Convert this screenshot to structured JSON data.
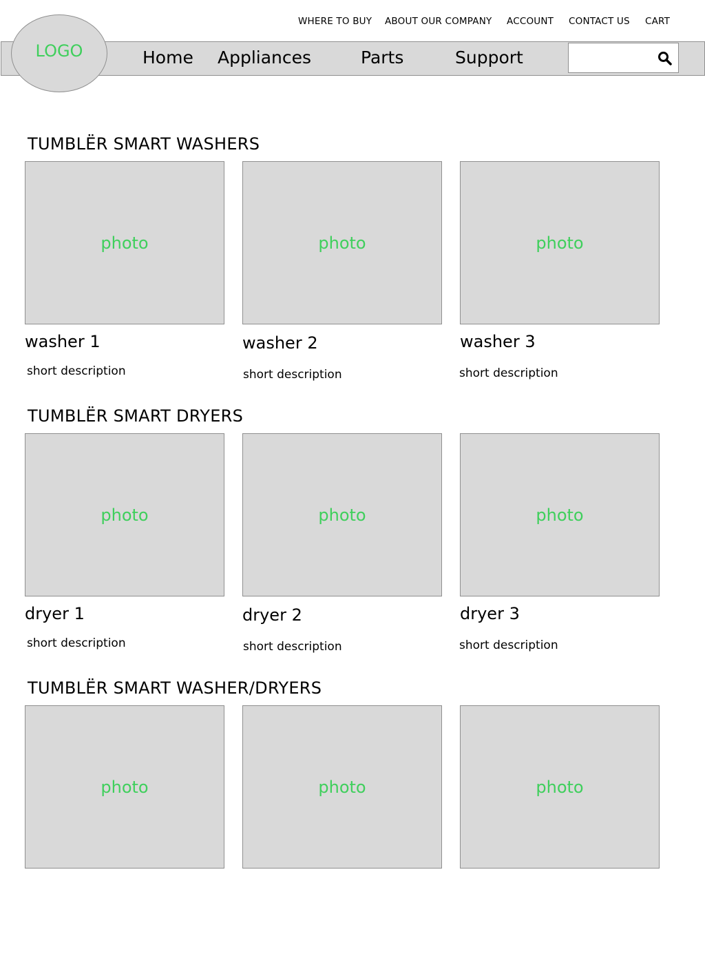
{
  "header": {
    "logo": "LOGO",
    "utility_links": [
      "WHERE TO BUY",
      "ABOUT OUR COMPANY",
      "ACCOUNT",
      "CONTACT US",
      "CART"
    ],
    "main_nav": [
      "Home",
      "Appliances",
      "Parts",
      "Support"
    ],
    "search": {
      "value": "",
      "icon": "search-icon"
    }
  },
  "sections": [
    {
      "title": "TUMBLËR SMART WASHERS",
      "products": [
        {
          "photo": "photo",
          "name": "washer 1",
          "description": "short description"
        },
        {
          "photo": "photo",
          "name": "washer 2",
          "description": "short description"
        },
        {
          "photo": "photo",
          "name": "washer 3",
          "description": "short description"
        }
      ]
    },
    {
      "title": "TUMBLËR SMART DRYERS",
      "products": [
        {
          "photo": "photo",
          "name": "dryer 1",
          "description": "short description"
        },
        {
          "photo": "photo",
          "name": "dryer 2",
          "description": "short description"
        },
        {
          "photo": "photo",
          "name": "dryer 3",
          "description": "short description"
        }
      ]
    },
    {
      "title": "TUMBLËR SMART WASHER/DRYERS",
      "products": [
        {
          "photo": "photo"
        },
        {
          "photo": "photo"
        },
        {
          "photo": "photo"
        }
      ]
    }
  ],
  "colors": {
    "placeholder_fill": "#d9d9d9",
    "placeholder_text": "#3fcf5c",
    "border": "#8f8f8f"
  }
}
